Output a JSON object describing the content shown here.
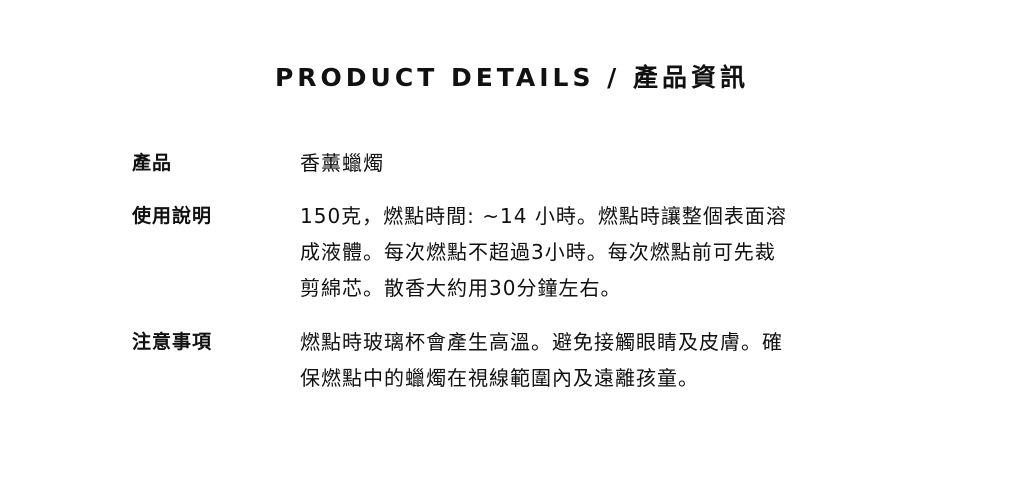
{
  "title": "PRODUCT DETAILS / 產品資訊",
  "rows": [
    {
      "label": "產品",
      "lines": [
        "香薰蠟燭"
      ]
    },
    {
      "label": "使用說明",
      "lines": [
        "150克，燃點時間: ~14 小時。燃點時讓整個表面溶",
        "成液體。每次燃點不超過3小時。每次燃點前可先裁",
        "剪綿芯。散香大約用30分鐘左右。"
      ]
    },
    {
      "label": "注意事項",
      "lines": [
        "燃點時玻璃杯會產生高溫。避免接觸眼睛及皮膚。確",
        "保燃點中的蠟燭在視線範圍內及遠離孩童。"
      ]
    }
  ]
}
